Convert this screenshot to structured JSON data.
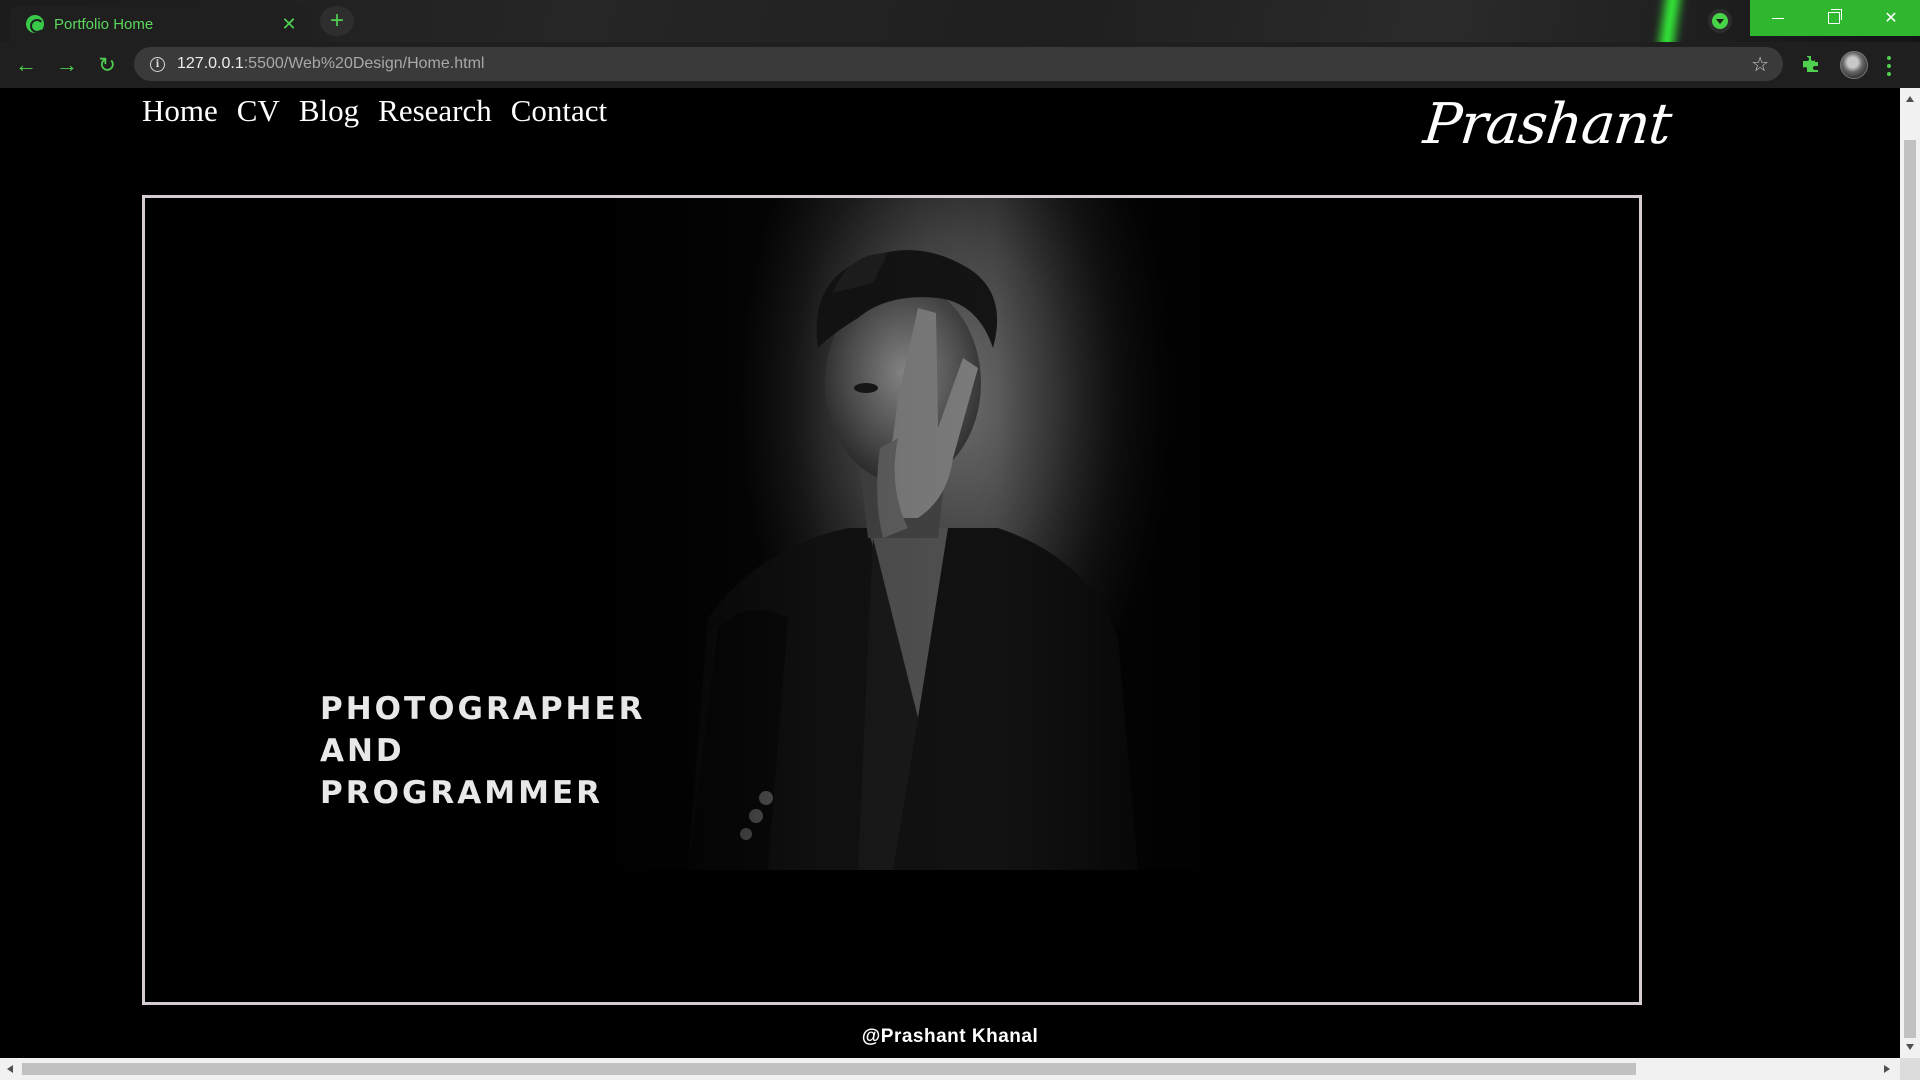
{
  "browser": {
    "tab_title": "Portfolio Home",
    "tab_close": "✕",
    "new_tab": "+",
    "url_host": "127.0.0.1",
    "url_rest": ":5500/Web%20Design/Home.html",
    "info_glyph": "i",
    "star_glyph": "☆",
    "back_glyph": "←",
    "forward_glyph": "→",
    "reload_glyph": "↻",
    "close_glyph": "✕",
    "accent_color": "#4fd04f",
    "icons": [
      "site-favicon",
      "close-icon",
      "plus-icon",
      "download-badge-icon",
      "minimize-icon",
      "restore-icon",
      "close-window-icon",
      "back-icon",
      "forward-icon",
      "reload-icon",
      "info-icon",
      "star-icon",
      "extensions-icon",
      "avatar",
      "menu-icon"
    ]
  },
  "page": {
    "nav": [
      {
        "label": "Home"
      },
      {
        "label": "CV"
      },
      {
        "label": "Blog"
      },
      {
        "label": "Research"
      },
      {
        "label": "Contact"
      }
    ],
    "brand": "Prashant",
    "tagline": [
      "PHOTOGRAPHER",
      "AND",
      "PROGRAMMER"
    ],
    "footer": "@Prashant Khanal",
    "frame_border_color": "#d6cbd3"
  }
}
